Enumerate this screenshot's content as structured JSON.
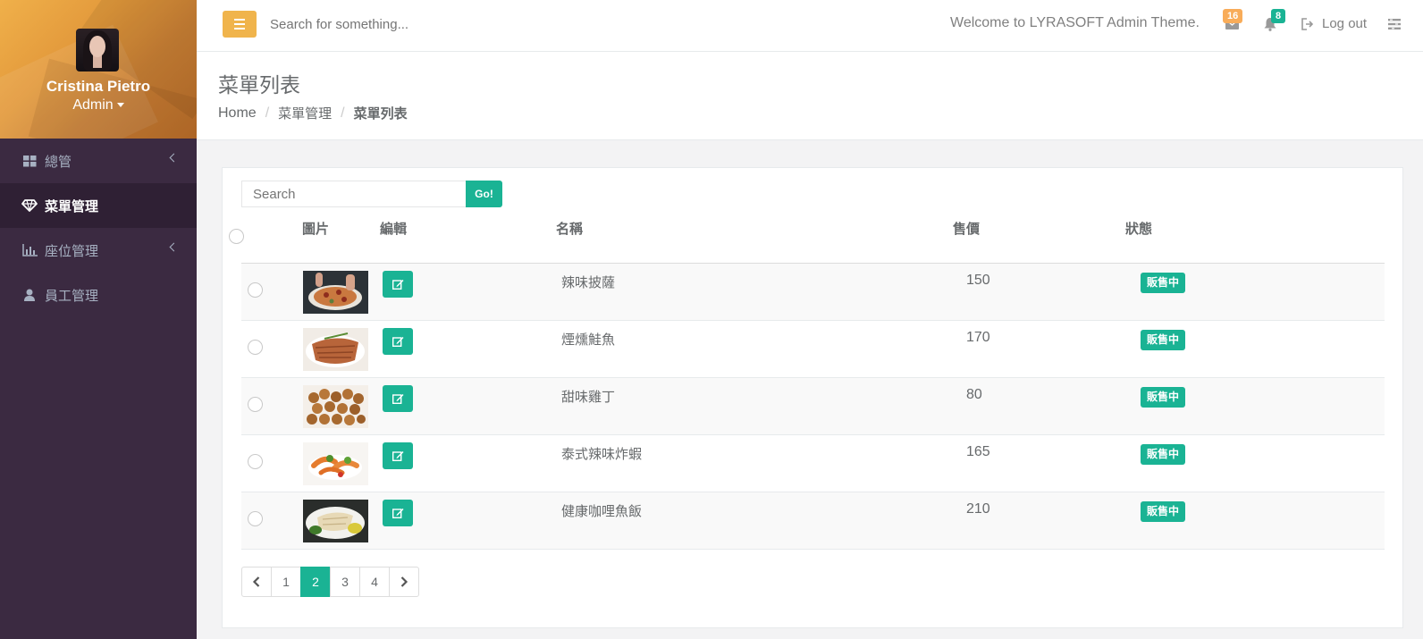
{
  "user": {
    "name": "Cristina Pietro",
    "role": "Admin"
  },
  "sidebar": {
    "items": [
      {
        "label": "總管",
        "icon": "th-large-icon",
        "has_submenu": true,
        "active": false
      },
      {
        "label": "菜單管理",
        "icon": "diamond-icon",
        "has_submenu": false,
        "active": true
      },
      {
        "label": "座位管理",
        "icon": "bar-chart-icon",
        "has_submenu": true,
        "active": false
      },
      {
        "label": "員工管理",
        "icon": "user-icon",
        "has_submenu": false,
        "active": false
      }
    ]
  },
  "topbar": {
    "search_placeholder": "Search for something...",
    "welcome": "Welcome to LYRASOFT Admin Theme.",
    "messages_count": "16",
    "alerts_count": "8",
    "logout_label": "Log out"
  },
  "heading": {
    "title": "菜單列表",
    "breadcrumb": [
      "Home",
      "菜單管理",
      "菜單列表"
    ]
  },
  "table": {
    "search_placeholder": "Search",
    "go_label": "Go!",
    "columns": [
      "圖片",
      "編輯",
      "名稱",
      "售價",
      "狀態"
    ],
    "rows": [
      {
        "name": "辣味披薩",
        "price": "150",
        "status": "販售中",
        "image": "pizza-photo"
      },
      {
        "name": "煙燻鮭魚",
        "price": "170",
        "status": "販售中",
        "image": "smoked-salmon-photo"
      },
      {
        "name": "甜味雞丁",
        "price": "80",
        "status": "販售中",
        "image": "chicken-bites-photo"
      },
      {
        "name": "泰式辣味炸蝦",
        "price": "165",
        "status": "販售中",
        "image": "thai-shrimp-photo"
      },
      {
        "name": "健康咖哩魚飯",
        "price": "210",
        "status": "販售中",
        "image": "curry-fish-photo"
      }
    ]
  },
  "pagination": {
    "pages": [
      "1",
      "2",
      "3",
      "4"
    ],
    "current": "2"
  },
  "colors": {
    "primary": "#1ab394",
    "warning": "#f8ac59",
    "sidebar_bg": "#3b2a41",
    "menu_button": "#f0b44c"
  }
}
